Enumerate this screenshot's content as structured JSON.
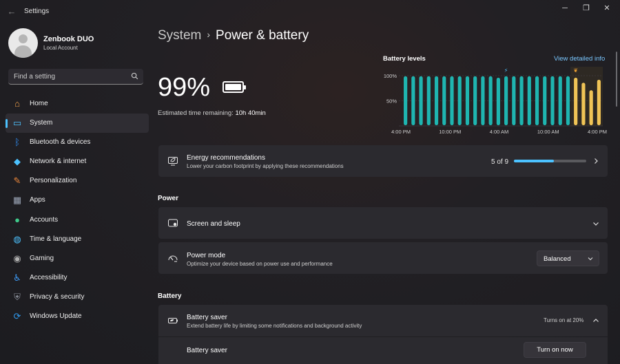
{
  "window": {
    "title": "Settings"
  },
  "account": {
    "name": "Zenbook DUO",
    "type": "Local Account"
  },
  "search": {
    "placeholder": "Find a setting"
  },
  "nav": {
    "items": [
      {
        "label": "Home",
        "icon": "home-icon",
        "color": "#f3a24b"
      },
      {
        "label": "System",
        "icon": "system-icon",
        "color": "#4cc2ff",
        "active": true
      },
      {
        "label": "Bluetooth & devices",
        "icon": "bluetooth-icon",
        "color": "#2f8cf0"
      },
      {
        "label": "Network & internet",
        "icon": "wifi-icon",
        "color": "#4cc2ff"
      },
      {
        "label": "Personalization",
        "icon": "brush-icon",
        "color": "#f08a3c"
      },
      {
        "label": "Apps",
        "icon": "apps-icon",
        "color": "#9aa4b5"
      },
      {
        "label": "Accounts",
        "icon": "person-icon",
        "color": "#3ec88a"
      },
      {
        "label": "Time & language",
        "icon": "globe-icon",
        "color": "#4cc2ff"
      },
      {
        "label": "Gaming",
        "icon": "gamepad-icon",
        "color": "#b0b0b0"
      },
      {
        "label": "Accessibility",
        "icon": "accessibility-icon",
        "color": "#3fa0ff"
      },
      {
        "label": "Privacy & security",
        "icon": "shield-icon",
        "color": "#8a8f99"
      },
      {
        "label": "Windows Update",
        "icon": "update-icon",
        "color": "#2f9bf0"
      }
    ]
  },
  "breadcrumb": {
    "parent": "System",
    "separator": "›",
    "current": "Power & battery"
  },
  "battery": {
    "percent": "99%",
    "level": 0.99,
    "estimate_label": "Estimated time remaining:",
    "estimate_value": "10h 40min"
  },
  "chart_data": {
    "type": "bar",
    "title": "Battery levels",
    "link": "View detailed info",
    "y_ticks": [
      "100%",
      "50%"
    ],
    "x_ticks": [
      "4:00 PM",
      "10:00 PM",
      "4:00 AM",
      "10:00 AM",
      "4:00 PM"
    ],
    "ylim": [
      0,
      100
    ],
    "bars": [
      {
        "value": 99,
        "state": "charging"
      },
      {
        "value": 99,
        "state": "charging"
      },
      {
        "value": 99,
        "state": "charging"
      },
      {
        "value": 99,
        "state": "charging"
      },
      {
        "value": 99,
        "state": "charging"
      },
      {
        "value": 99,
        "state": "charging"
      },
      {
        "value": 99,
        "state": "charging"
      },
      {
        "value": 99,
        "state": "charging"
      },
      {
        "value": 99,
        "state": "charging"
      },
      {
        "value": 99,
        "state": "charging"
      },
      {
        "value": 99,
        "state": "charging"
      },
      {
        "value": 99,
        "state": "charging"
      },
      {
        "value": 96,
        "state": "charging"
      },
      {
        "value": 99,
        "state": "charging"
      },
      {
        "value": 99,
        "state": "charging"
      },
      {
        "value": 99,
        "state": "charging"
      },
      {
        "value": 99,
        "state": "charging"
      },
      {
        "value": 99,
        "state": "charging"
      },
      {
        "value": 99,
        "state": "charging"
      },
      {
        "value": 99,
        "state": "charging"
      },
      {
        "value": 99,
        "state": "charging"
      },
      {
        "value": 99,
        "state": "charging"
      },
      {
        "value": 96,
        "state": "battery"
      },
      {
        "value": 86,
        "state": "battery"
      },
      {
        "value": 71,
        "state": "battery"
      },
      {
        "value": 92,
        "state": "battery"
      }
    ],
    "colors": {
      "charging": "#1fb5b0",
      "battery": "#f0c456"
    }
  },
  "energy": {
    "title": "Energy recommendations",
    "subtitle": "Lower your carbon footprint by applying these recommendations",
    "count": "5 of 9",
    "progress": 0.555
  },
  "power": {
    "heading": "Power",
    "screen_sleep": "Screen and sleep",
    "mode_title": "Power mode",
    "mode_subtitle": "Optimize your device based on power use and performance",
    "mode_value": "Balanced"
  },
  "battery_section": {
    "heading": "Battery",
    "saver_title": "Battery saver",
    "saver_subtitle": "Extend battery life by limiting some notifications and background activity",
    "saver_status": "Turns on at 20%",
    "saver_row_label": "Battery saver",
    "turn_on_label": "Turn on now"
  }
}
